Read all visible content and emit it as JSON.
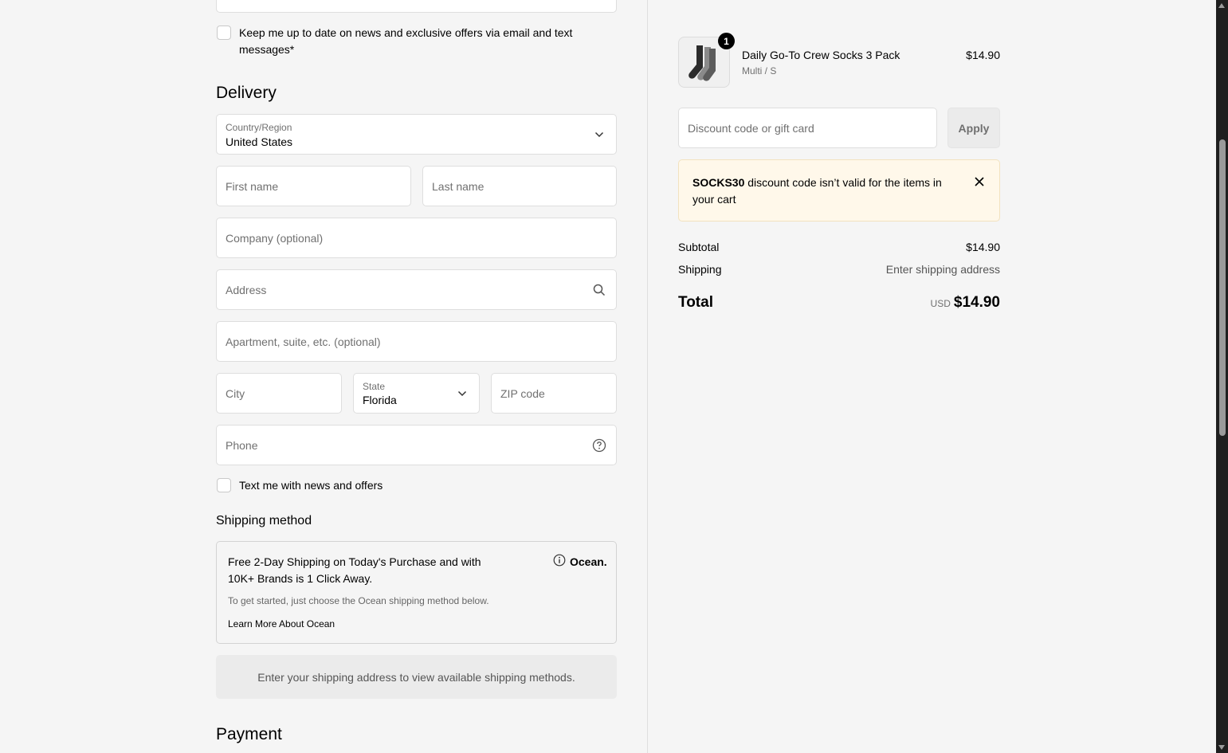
{
  "contact": {
    "news_checkbox_label": "Keep me up to date on news and exclusive offers via email and text messages*"
  },
  "delivery": {
    "title": "Delivery",
    "country_label": "Country/Region",
    "country_value": "United States",
    "first_name_placeholder": "First name",
    "last_name_placeholder": "Last name",
    "company_placeholder": "Company (optional)",
    "address_placeholder": "Address",
    "apartment_placeholder": "Apartment, suite, etc. (optional)",
    "city_placeholder": "City",
    "state_label": "State",
    "state_value": "Florida",
    "zip_placeholder": "ZIP code",
    "phone_placeholder": "Phone",
    "text_checkbox_label": "Text me with news and offers"
  },
  "shipping_method": {
    "title": "Shipping method",
    "ocean_headline": "Free 2-Day Shipping on Today's Purchase and with 10K+ Brands is 1 Click Away.",
    "ocean_brand": "Ocean.",
    "ocean_subtext": "To get started, just choose the Ocean shipping method below.",
    "ocean_link": "Learn More About Ocean",
    "note": "Enter your shipping address to view available shipping methods."
  },
  "payment": {
    "title": "Payment"
  },
  "cart": {
    "item": {
      "quantity": "1",
      "name": "Daily Go-To Crew Socks 3 Pack",
      "variant": "Multi / S",
      "price": "$14.90"
    },
    "discount_placeholder": "Discount code or gift card",
    "apply_label": "Apply",
    "alert_code": "SOCKS30",
    "alert_text": " discount code isn’t valid for the items in your cart",
    "subtotal_label": "Subtotal",
    "subtotal_value": "$14.90",
    "shipping_label": "Shipping",
    "shipping_value": "Enter shipping address",
    "total_label": "Total",
    "total_currency": "USD",
    "total_value": "$14.90"
  },
  "colors": {
    "alert_bg": "#fff8ea",
    "badge_bg": "#000000",
    "field_border": "#dedede"
  }
}
